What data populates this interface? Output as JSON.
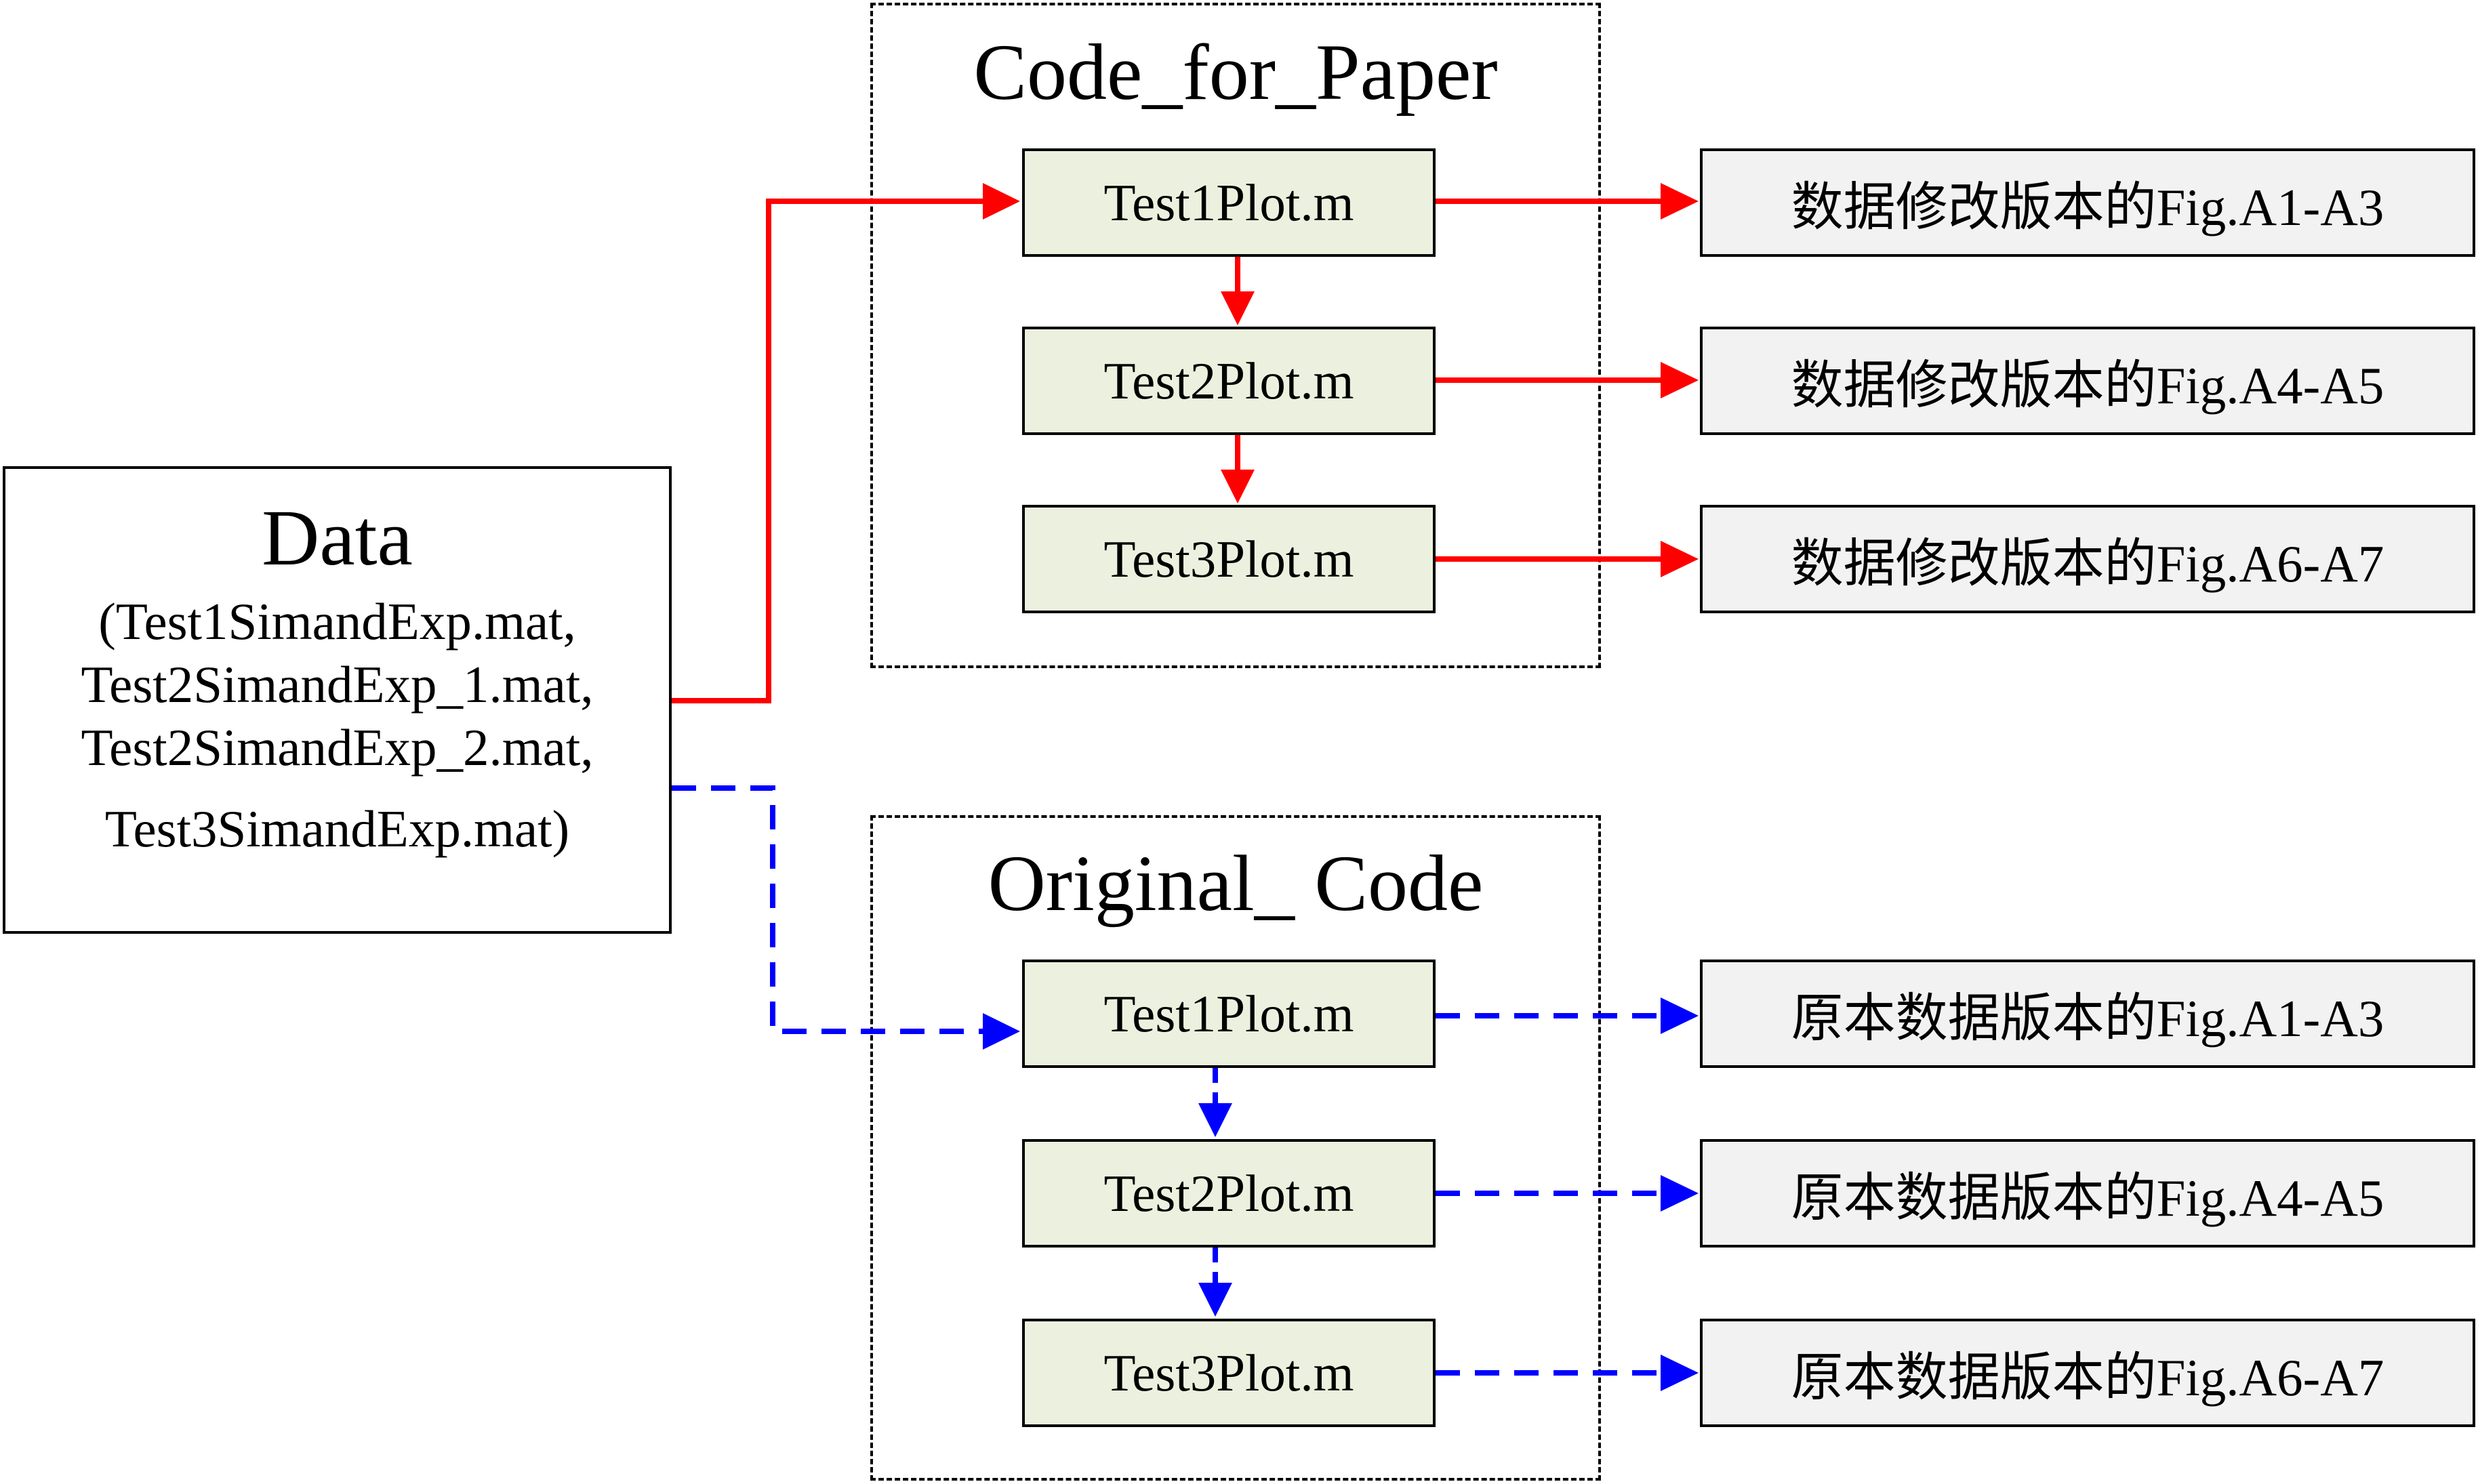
{
  "data_block": {
    "title": "Data",
    "lines": [
      "(Test1SimandExp.mat,",
      "Test2SimandExp_1.mat,",
      "Test2SimandExp_2.mat,",
      "Test3SimandExp.mat)"
    ]
  },
  "groups": [
    {
      "title": "Code_for_Paper",
      "line_style": "solid",
      "color": "#ff0000",
      "scripts": [
        "Test1Plot.m",
        "Test2Plot.m",
        "Test3Plot.m"
      ],
      "outputs": [
        "数据修改版本的Fig.A1-A3",
        "数据修改版本的Fig.A4-A5",
        "数据修改版本的Fig.A6-A7"
      ]
    },
    {
      "title": "Original_ Code",
      "line_style": "dashed",
      "color": "#0000ff",
      "scripts": [
        "Test1Plot.m",
        "Test2Plot.m",
        "Test3Plot.m"
      ],
      "outputs": [
        "原本数据版本的Fig.A1-A3",
        "原本数据版本的Fig.A4-A5",
        "原本数据版本的Fig.A6-A7"
      ]
    }
  ],
  "colors": {
    "script_fill": "#ebf1de",
    "output_fill": "#f2f2f2",
    "border": "#000000"
  }
}
